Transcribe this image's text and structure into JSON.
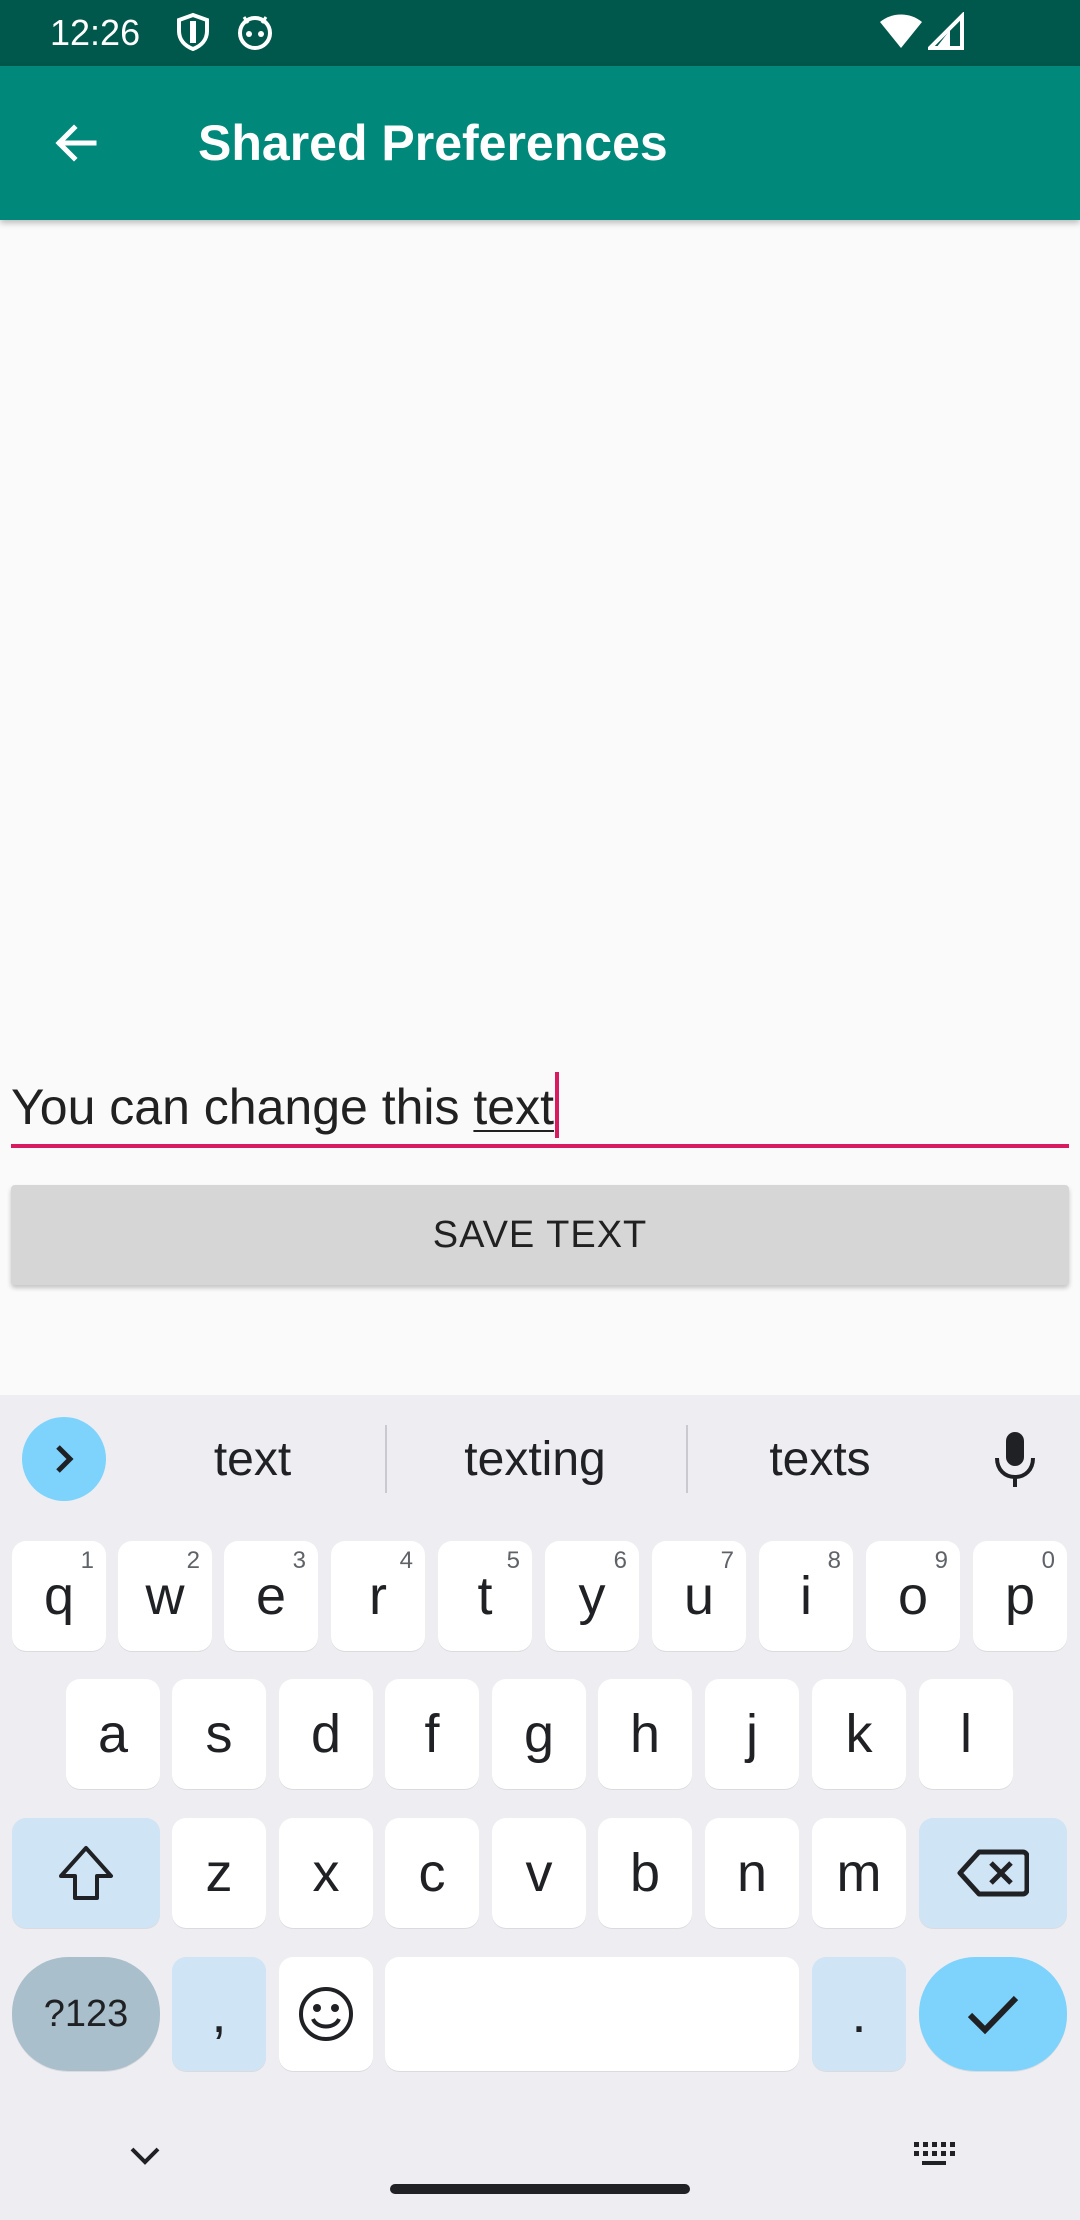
{
  "status_bar": {
    "time": "12:26",
    "icons": [
      "shield-icon",
      "android-icon",
      "wifi-icon",
      "signal-icon"
    ]
  },
  "app_bar": {
    "title": "Shared Preferences",
    "back_icon": "back-arrow-icon"
  },
  "editor": {
    "text_before": "You can change this ",
    "text_composing": "text"
  },
  "save_button": {
    "label": "SAVE TEXT"
  },
  "keyboard": {
    "suggestions": [
      "text",
      "texting",
      "texts"
    ],
    "row1": [
      {
        "key": "q",
        "hint": "1"
      },
      {
        "key": "w",
        "hint": "2"
      },
      {
        "key": "e",
        "hint": "3"
      },
      {
        "key": "r",
        "hint": "4"
      },
      {
        "key": "t",
        "hint": "5"
      },
      {
        "key": "y",
        "hint": "6"
      },
      {
        "key": "u",
        "hint": "7"
      },
      {
        "key": "i",
        "hint": "8"
      },
      {
        "key": "o",
        "hint": "9"
      },
      {
        "key": "p",
        "hint": "0"
      }
    ],
    "row2": [
      "a",
      "s",
      "d",
      "f",
      "g",
      "h",
      "j",
      "k",
      "l"
    ],
    "row3": [
      "z",
      "x",
      "c",
      "v",
      "b",
      "n",
      "m"
    ],
    "symbols_label": "?123",
    "comma": ",",
    "period": "."
  },
  "colors": {
    "status_bar": "#00574b",
    "app_bar": "#00897b",
    "accent": "#d81b60",
    "keyboard_accent": "#7dd3fc"
  }
}
